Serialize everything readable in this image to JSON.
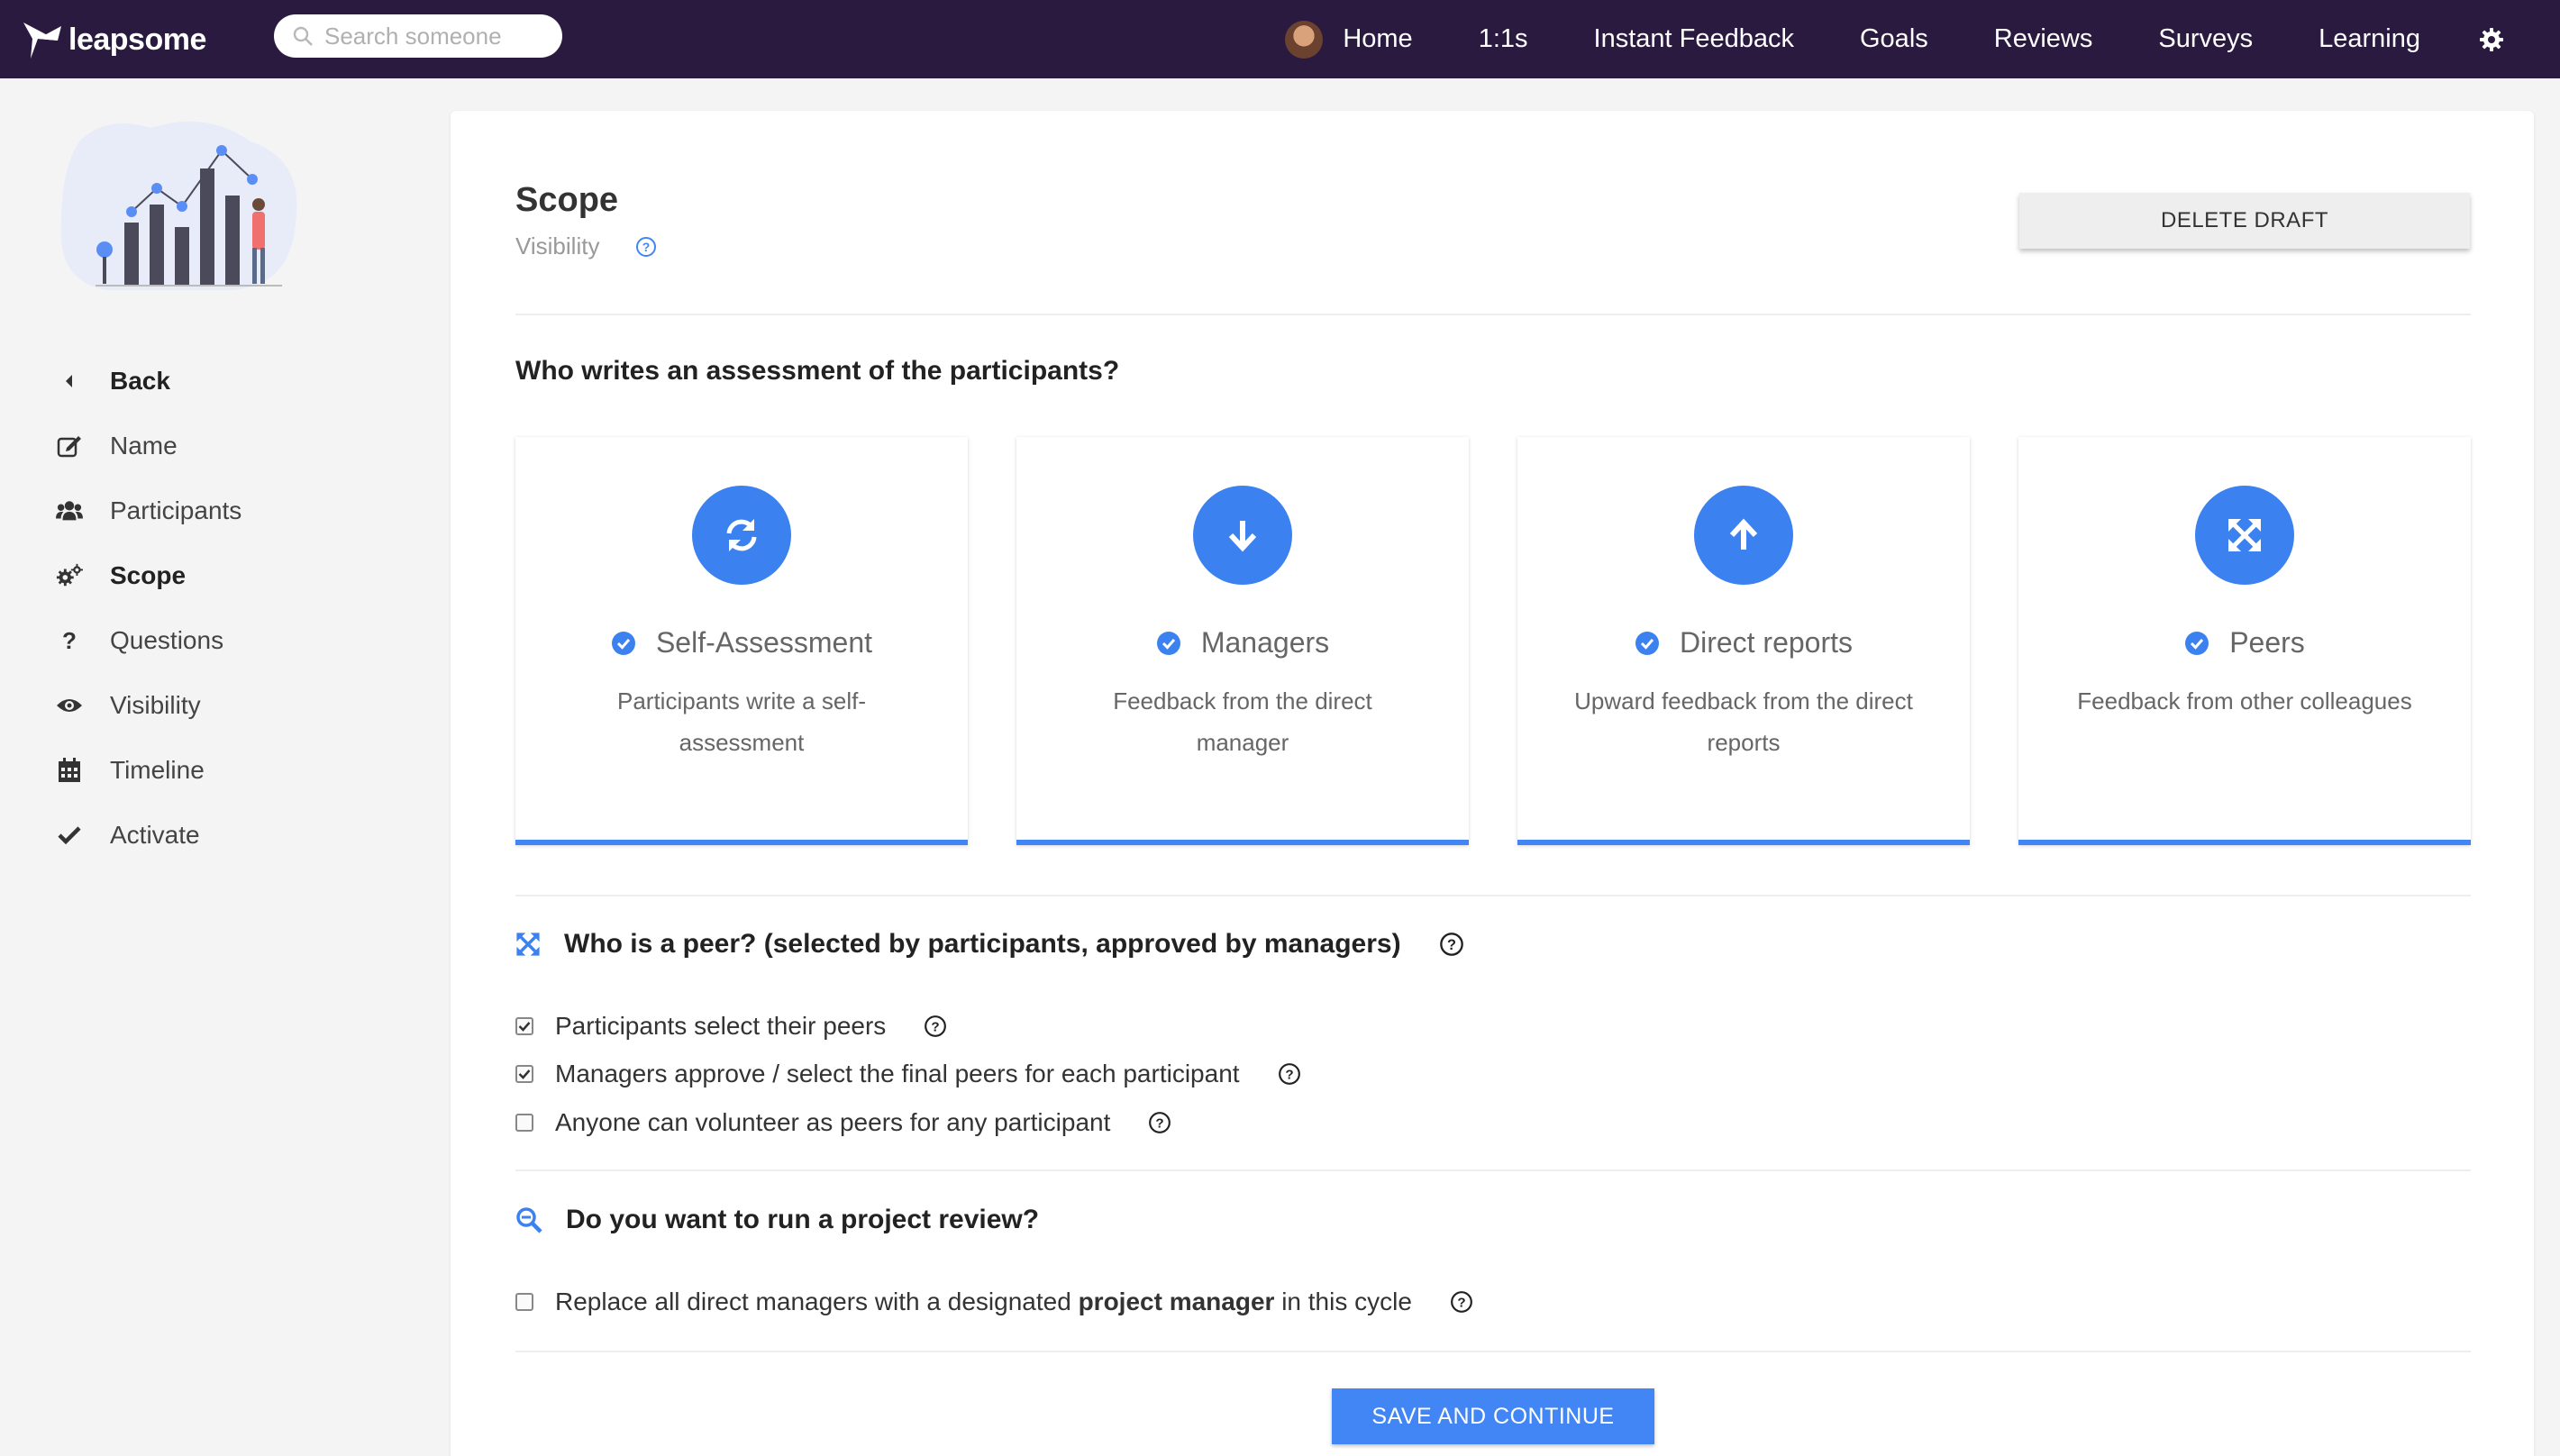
{
  "brand": {
    "name": "leapsome"
  },
  "search": {
    "placeholder": "Search someone"
  },
  "nav": {
    "items": [
      "Home",
      "1:1s",
      "Instant Feedback",
      "Goals",
      "Reviews",
      "Surveys",
      "Learning"
    ]
  },
  "sidebar": {
    "items": [
      {
        "label": "Back",
        "icon": "caret-left-icon"
      },
      {
        "label": "Name",
        "icon": "edit-icon"
      },
      {
        "label": "Participants",
        "icon": "users-icon"
      },
      {
        "label": "Scope",
        "icon": "gears-icon"
      },
      {
        "label": "Questions",
        "icon": "question-icon"
      },
      {
        "label": "Visibility",
        "icon": "eye-icon"
      },
      {
        "label": "Timeline",
        "icon": "calendar-icon"
      },
      {
        "label": "Activate",
        "icon": "check-icon"
      }
    ]
  },
  "header": {
    "title": "Scope",
    "subtitle": "Visibility",
    "delete_label": "DELETE DRAFT"
  },
  "assessment": {
    "title": "Who writes an assessment of the participants?",
    "types": [
      {
        "name": "Self-Assessment",
        "desc": "Participants write a self-assessment",
        "icon": "refresh-icon",
        "selected": true
      },
      {
        "name": "Managers",
        "desc": "Feedback from the direct manager",
        "icon": "arrow-down-icon",
        "selected": true
      },
      {
        "name": "Direct reports",
        "desc": "Upward feedback from the direct reports",
        "icon": "arrow-up-icon",
        "selected": true
      },
      {
        "name": "Peers",
        "desc": "Feedback from other colleagues",
        "icon": "expand-icon",
        "selected": true
      }
    ]
  },
  "peers": {
    "title": "Who is a peer? (selected by participants, approved by managers)",
    "options": [
      {
        "label": "Participants select their peers",
        "checked": true
      },
      {
        "label": "Managers approve / select the final peers for each participant",
        "checked": true
      },
      {
        "label": "Anyone can volunteer as peers for any participant",
        "checked": false
      }
    ]
  },
  "project": {
    "title": "Do you want to run a project review?",
    "option_pre": "Replace all direct managers with a designated ",
    "option_bold": "project manager",
    "option_post": " in this cycle",
    "checked": false
  },
  "footer": {
    "save_label": "SAVE AND CONTINUE"
  },
  "colors": {
    "nav_bg": "#2b1a3f",
    "accent": "#4285f4",
    "circle": "#3b82f0"
  }
}
